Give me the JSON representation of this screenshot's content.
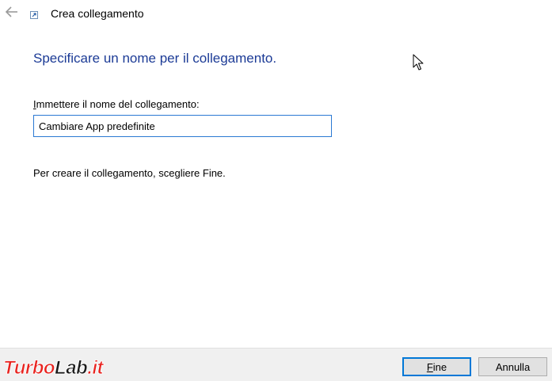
{
  "window": {
    "title": "Crea collegamento"
  },
  "page": {
    "heading": "Specificare un nome per il collegamento.",
    "field_label_accel": "I",
    "field_label_rest": "mmettere il nome del collegamento:",
    "name_value": "Cambiare App predefinite",
    "instruction": "Per creare il collegamento, scegliere Fine."
  },
  "footer": {
    "finish_accel": "F",
    "finish_rest": "ine",
    "cancel_label": "Annulla",
    "watermark_text": "TurboLab.it"
  },
  "icons": {
    "back": "back-arrow-icon",
    "app": "shortcut-icon",
    "cursor": "mouse-pointer-icon"
  },
  "colors": {
    "heading": "#1c3b96",
    "input_border": "#2b79d3",
    "default_button_border": "#0078d7",
    "footer_bg": "#f0f0f0",
    "watermark_red": "#e8231f"
  }
}
